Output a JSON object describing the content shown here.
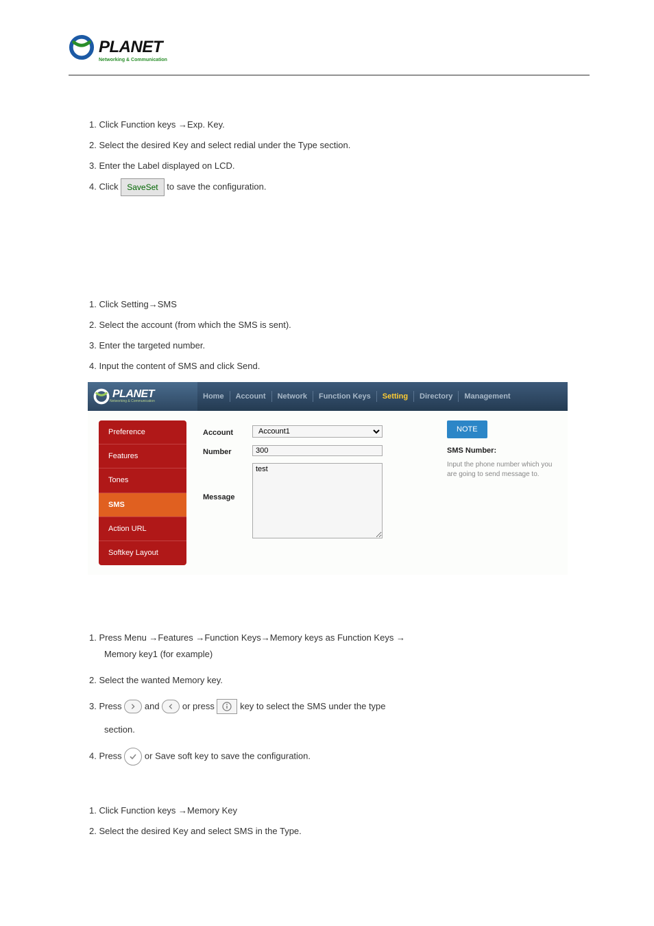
{
  "logo": {
    "brand": "PLANET",
    "tagline": "Networking & Communication"
  },
  "list1": {
    "i1": "1.  Click Function keys →Exp. Key.",
    "i2": "2.  Select the desired Key and select redial under the Type section.",
    "i3": "3.  Enter the Label displayed on LCD.",
    "i4a": "4.  Click ",
    "i4btn": "SaveSet",
    "i4b": " to save the configuration."
  },
  "list2": {
    "i1": "1.  Click Setting→SMS",
    "i2": "2.  Select the account (from which the SMS is sent).",
    "i3": "3.  Enter the targeted number.",
    "i4": "4.  Input the content of SMS and click Send."
  },
  "screenshot": {
    "logo": {
      "brand": "PLANET",
      "tagline": "Networking & Communication"
    },
    "tabs": [
      "Home",
      "Account",
      "Network",
      "Function Keys",
      "Setting",
      "Directory",
      "Management"
    ],
    "sidebar": [
      "Preference",
      "Features",
      "Tones",
      "SMS",
      "Action URL",
      "Softkey Layout"
    ],
    "form": {
      "accountLabel": "Account",
      "accountValue": "Account1",
      "numberLabel": "Number",
      "numberValue": "300",
      "messageLabel": "Message",
      "messageValue": "test"
    },
    "note": {
      "badge": "NOTE",
      "title": "SMS Number:",
      "text": "Input the phone number which you are going to send message to."
    }
  },
  "list3": {
    "i1a": "1.  Press Menu →Features →Function Keys→Memory keys as Function Keys →",
    "i1b": "Memory key1 (for example)",
    "i2": "2.  Select the wanted Memory key.",
    "i3a": "3.  Press ",
    "i3b": " and ",
    "i3c": " or press ",
    "i3d": " key to select the SMS under the type",
    "i3e": "section.",
    "i4a": "4.  Press ",
    "i4b": " or Save soft key to save the configuration."
  },
  "list4": {
    "i1": "1.  Click Function keys →Memory Key",
    "i2": "2.  Select the desired Key and select SMS in the Type."
  }
}
